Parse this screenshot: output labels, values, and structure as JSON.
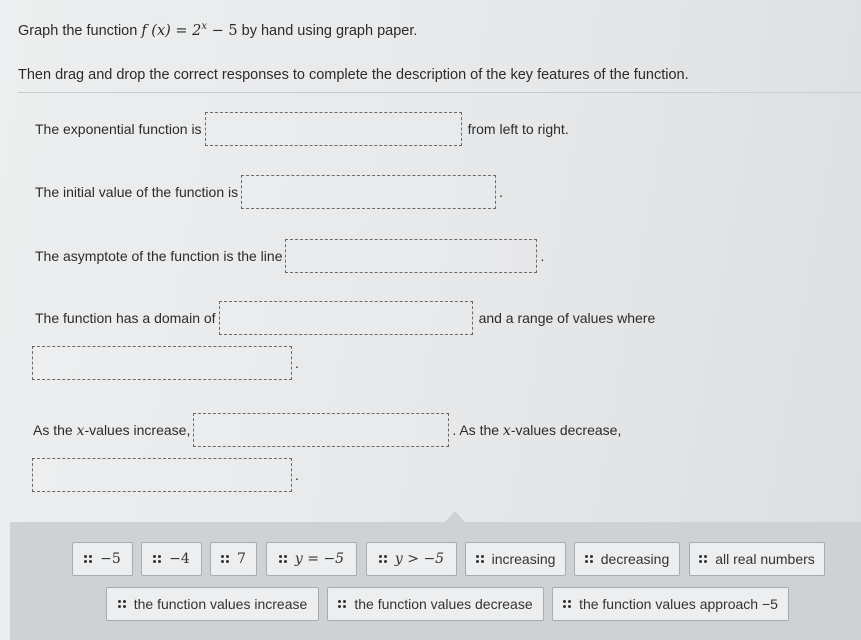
{
  "instructions": {
    "line1_before": "Graph the function ",
    "function_lhs": "f (x) = 2",
    "function_exponent": "x",
    "function_rhs": " − 5",
    "line1_after": " by hand using graph paper.",
    "line2": "Then drag and drop the correct responses to complete the description of the key features of the function."
  },
  "statements": [
    {
      "before": "The exponential function is",
      "after": "from left to right."
    },
    {
      "before": "The initial value of the function is",
      "after": "."
    },
    {
      "before": "The asymptote of the function is the line",
      "after": "."
    },
    {
      "before": "The function has a domain of",
      "after": "and a range of values where"
    },
    {
      "before": "",
      "after": "."
    },
    {
      "before_prefix": "As the ",
      "before_var": "x",
      "before_suffix": "-values increase,",
      "after_prefix": ". As the ",
      "after_var": "x",
      "after_suffix": "-values decrease,"
    },
    {
      "before": "",
      "after": "."
    }
  ],
  "tiles_row1": [
    {
      "label": "−5",
      "math": true
    },
    {
      "label": "−4",
      "math": true
    },
    {
      "label": "7",
      "math": true
    },
    {
      "label": "y = −5",
      "math": true
    },
    {
      "label": "y > −5",
      "math": true
    },
    {
      "label": "increasing",
      "math": false
    },
    {
      "label": "decreasing",
      "math": false
    },
    {
      "label": "all real numbers",
      "math": false
    }
  ],
  "tiles_row2": [
    {
      "label": "the function values increase",
      "math": false
    },
    {
      "label": "the function values decrease",
      "math": false
    },
    {
      "label": "the function values approach −5",
      "math": false
    }
  ],
  "icons": {
    "tile_handle": "drag-handle-icon"
  }
}
